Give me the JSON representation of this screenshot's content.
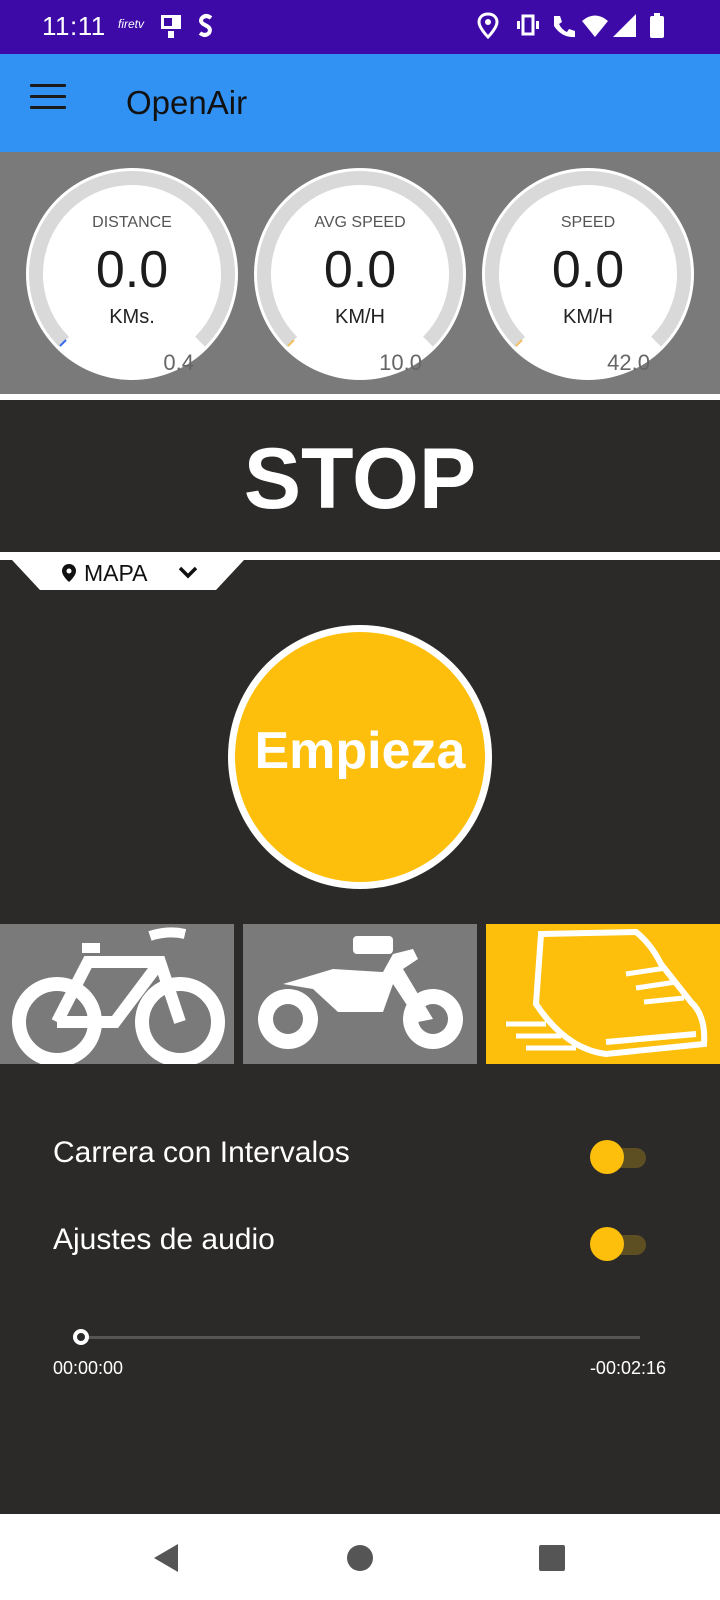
{
  "status_bar": {
    "time": "11:11",
    "firetv_label": "firetv",
    "icons": [
      "firetv-icon",
      "cast-icon",
      "dollar-icon",
      "location-icon",
      "vibrate-icon",
      "wifi-calling-icon",
      "wifi-icon",
      "signal-icon",
      "battery-icon"
    ]
  },
  "app_bar": {
    "title": "OpenAir",
    "menu_icon": "hamburger-menu-icon"
  },
  "gauges": [
    {
      "label": "DISTANCE",
      "value": "0.0",
      "unit": "KMs.",
      "max": "0.4",
      "needle_color": "#3a6cf0"
    },
    {
      "label": "AVG SPEED",
      "value": "0.0",
      "unit": "KM/H",
      "max": "10.0",
      "needle_color": "#f0c060"
    },
    {
      "label": "SPEED",
      "value": "0.0",
      "unit": "KM/H",
      "max": "42.0",
      "needle_color": "#f0c060"
    }
  ],
  "stop_label": "STOP",
  "map_selector": {
    "label": "MAPA",
    "icon": "map-pin-icon"
  },
  "start_button": {
    "label": "Empieza",
    "color": "#fdbf0b"
  },
  "activities": [
    {
      "name": "bicycle",
      "icon": "bicycle-icon",
      "selected": false
    },
    {
      "name": "motorcycle",
      "icon": "motorcycle-icon",
      "selected": false
    },
    {
      "name": "running",
      "icon": "running-shoe-icon",
      "selected": true
    }
  ],
  "settings": [
    {
      "label": "Carrera con Intervalos",
      "enabled": false
    },
    {
      "label": "Ajustes de audio",
      "enabled": false
    }
  ],
  "audio_seek": {
    "elapsed": "00:00:00",
    "remaining": "-00:02:16",
    "progress": 0
  },
  "colors": {
    "accent": "#fdbf0b",
    "app_bar": "#3292f4",
    "status_bar": "#3d0aa8",
    "background": "#2b2a29"
  }
}
